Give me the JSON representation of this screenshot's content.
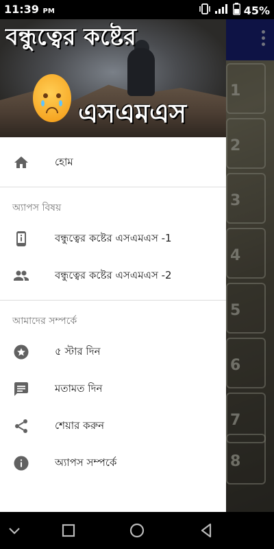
{
  "status_bar": {
    "time": "11:39",
    "ampm": "PM",
    "battery_percent": "45%",
    "icons": [
      "vibrate-icon",
      "signal-icon",
      "battery-icon"
    ]
  },
  "background_app": {
    "card_numbers": [
      "1",
      "2",
      "3",
      "4",
      "5",
      "6",
      "7",
      "8"
    ]
  },
  "drawer": {
    "header": {
      "title_top": "বন্ধুত্বের কষ্টের",
      "title_bottom": "এসএমএস"
    },
    "items": [
      {
        "label": "হোম",
        "icon": "home-icon"
      }
    ],
    "section_apps": {
      "title": "অ্যাপস বিষয়",
      "items": [
        {
          "label": "বন্ধুত্বের কষ্টের এসএমএস -1",
          "icon": "phone-info-icon"
        },
        {
          "label": "বন্ধুত্বের কষ্টের এসএমএস -2",
          "icon": "people-icon"
        }
      ]
    },
    "section_about": {
      "title": "আমাদের সম্পর্কে",
      "items": [
        {
          "label": "৫ স্টার দিন",
          "icon": "star-icon"
        },
        {
          "label": "মতামত দিন",
          "icon": "feedback-icon"
        },
        {
          "label": "শেয়ার করুন",
          "icon": "share-icon"
        },
        {
          "label": "অ্যাপস সম্পর্কে",
          "icon": "info-icon"
        }
      ]
    }
  },
  "nav_bar": {
    "buttons": [
      "back-chevron-icon",
      "recents-icon",
      "home-circle-icon",
      "back-triangle-icon"
    ]
  }
}
